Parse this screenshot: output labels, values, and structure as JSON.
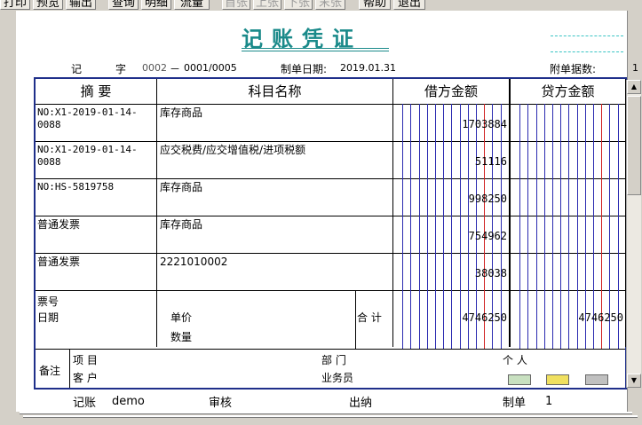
{
  "toolbar": {
    "buttons": [
      "打印",
      "预览",
      "输出",
      "查询",
      "明细",
      "流量",
      "首张",
      "上张",
      "下张",
      "末张",
      "帮助",
      "退出"
    ]
  },
  "header": {
    "title": "记账凭证",
    "type_char": "记",
    "zi_label": "字",
    "voucher_type_code": "0002",
    "dash": "－",
    "voucher_no": "0001/0005",
    "date_label": "制单日期:",
    "date_value": "2019.01.31",
    "attach_label": "附单据数:",
    "attach_value": "1"
  },
  "columns": {
    "summary": "摘  要",
    "account": "科目名称",
    "debit": "借方金额",
    "credit": "贷方金额"
  },
  "entries": [
    {
      "summary": "NO:X1-2019-01-14-0088",
      "account": "库存商品",
      "debit": "1703884",
      "credit": ""
    },
    {
      "summary": "NO:X1-2019-01-14-0088",
      "account": "应交税费/应交增值税/进项税额",
      "debit": "51116",
      "credit": ""
    },
    {
      "summary": "NO:HS-5819758",
      "account": "库存商品",
      "debit": "998250",
      "credit": ""
    },
    {
      "summary": "普通发票",
      "account": "库存商品",
      "debit": "754962",
      "credit": ""
    },
    {
      "summary": "普通发票",
      "account": "2221010002",
      "debit": "38038",
      "credit": ""
    }
  ],
  "totals": {
    "ticket_label": "票号",
    "date_label": "日期",
    "price_label": "单价",
    "qty_label": "数量",
    "total_label": "合 计",
    "debit_total": "4746250",
    "credit_total": "4746250"
  },
  "notes": {
    "label": "备注",
    "project_label": "项  目",
    "customer_label": "客  户",
    "dept_label": "部  门",
    "staff_label": "业务员",
    "person_label": "个  人"
  },
  "footer": {
    "bookkeeper_label": "记账",
    "bookkeeper_value": "demo",
    "audit_label": "审核",
    "cashier_label": "出纳",
    "maker_label": "制单",
    "maker_value": "1"
  },
  "colors": {
    "title": "#1a8a8a",
    "border": "#1f2f8a",
    "grid_blue": "#2a2ab0",
    "grid_red": "#d02020"
  }
}
